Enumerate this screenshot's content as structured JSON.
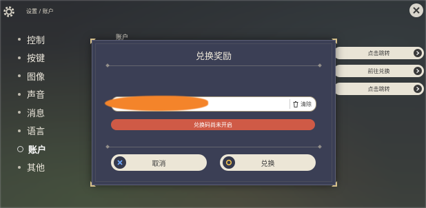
{
  "breadcrumb": "设置 / 账户",
  "sidebar": {
    "items": [
      {
        "label": "控制"
      },
      {
        "label": "按键"
      },
      {
        "label": "图像"
      },
      {
        "label": "声音"
      },
      {
        "label": "消息"
      },
      {
        "label": "语言"
      },
      {
        "label": "账户"
      },
      {
        "label": "其他"
      }
    ],
    "active_index": 6
  },
  "main": {
    "section_title": "账户",
    "right_buttons": [
      {
        "label": "点击跳转"
      },
      {
        "label": "前往兑换"
      },
      {
        "label": "点击跳转"
      }
    ]
  },
  "dialog": {
    "title": "兑换奖励",
    "code_input": {
      "value": "",
      "placeholder": ""
    },
    "clear_label": "清除",
    "error_message": "兑换码尚未开启",
    "cancel_label": "取消",
    "confirm_label": "兑换"
  },
  "icons": {
    "settings": "gear-icon",
    "close": "close-icon",
    "trash": "trash-icon",
    "cancel": "cross-icon",
    "confirm": "circle-icon",
    "arrow": "arrow-right-icon"
  },
  "colors": {
    "dialog_bg": "#3b3f55",
    "error": "#cf5a46",
    "button_bg": "#ece6d6",
    "accent_gold": "#d6c089"
  }
}
